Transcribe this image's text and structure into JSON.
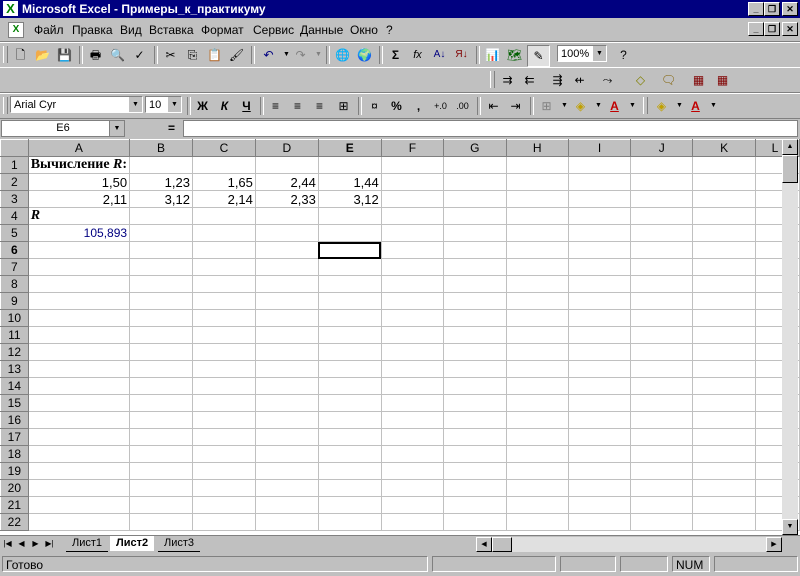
{
  "window": {
    "title": "Microsoft Excel - Примеры_к_практикуму"
  },
  "menu": [
    "Файл",
    "Правка",
    "Вид",
    "Вставка",
    "Формат",
    "Сервис",
    "Данные",
    "Окно",
    "?"
  ],
  "toolbar": {
    "zoom": "100%",
    "font": "Arial Cyr",
    "size": "10",
    "bold": "Ж",
    "italic": "К",
    "underline": "Ч",
    "percent": "%",
    "comma": ","
  },
  "formula_bar": {
    "cell_ref": "E6",
    "equals": "=",
    "content": ""
  },
  "grid": {
    "columns": [
      "A",
      "B",
      "C",
      "D",
      "E",
      "F",
      "G",
      "H",
      "I",
      "J",
      "K",
      "L"
    ],
    "active_column": "E",
    "active_row": 6,
    "rows": [
      {
        "n": "1",
        "cells": [
          "Вычисление R:",
          "",
          "",
          "",
          "",
          "",
          "",
          "",
          "",
          "",
          "",
          ""
        ]
      },
      {
        "n": "2",
        "cells": [
          "1,50",
          "1,23",
          "1,65",
          "2,44",
          "1,44",
          "",
          "",
          "",
          "",
          "",
          "",
          ""
        ]
      },
      {
        "n": "3",
        "cells": [
          "2,11",
          "3,12",
          "2,14",
          "2,33",
          "3,12",
          "",
          "",
          "",
          "",
          "",
          "",
          ""
        ]
      },
      {
        "n": "4",
        "cells": [
          "R",
          "",
          "",
          "",
          "",
          "",
          "",
          "",
          "",
          "",
          "",
          ""
        ]
      },
      {
        "n": "5",
        "cells": [
          "105,893",
          "",
          "",
          "",
          "",
          "",
          "",
          "",
          "",
          "",
          "",
          ""
        ]
      },
      {
        "n": "6",
        "cells": [
          "",
          "",
          "",
          "",
          "",
          "",
          "",
          "",
          "",
          "",
          "",
          ""
        ]
      },
      {
        "n": "7",
        "cells": [
          "",
          "",
          "",
          "",
          "",
          "",
          "",
          "",
          "",
          "",
          "",
          ""
        ]
      },
      {
        "n": "8",
        "cells": [
          "",
          "",
          "",
          "",
          "",
          "",
          "",
          "",
          "",
          "",
          "",
          ""
        ]
      },
      {
        "n": "9",
        "cells": [
          "",
          "",
          "",
          "",
          "",
          "",
          "",
          "",
          "",
          "",
          "",
          ""
        ]
      },
      {
        "n": "10",
        "cells": [
          "",
          "",
          "",
          "",
          "",
          "",
          "",
          "",
          "",
          "",
          "",
          ""
        ]
      },
      {
        "n": "11",
        "cells": [
          "",
          "",
          "",
          "",
          "",
          "",
          "",
          "",
          "",
          "",
          "",
          ""
        ]
      },
      {
        "n": "12",
        "cells": [
          "",
          "",
          "",
          "",
          "",
          "",
          "",
          "",
          "",
          "",
          "",
          ""
        ]
      },
      {
        "n": "13",
        "cells": [
          "",
          "",
          "",
          "",
          "",
          "",
          "",
          "",
          "",
          "",
          "",
          ""
        ]
      },
      {
        "n": "14",
        "cells": [
          "",
          "",
          "",
          "",
          "",
          "",
          "",
          "",
          "",
          "",
          "",
          ""
        ]
      },
      {
        "n": "15",
        "cells": [
          "",
          "",
          "",
          "",
          "",
          "",
          "",
          "",
          "",
          "",
          "",
          ""
        ]
      },
      {
        "n": "16",
        "cells": [
          "",
          "",
          "",
          "",
          "",
          "",
          "",
          "",
          "",
          "",
          "",
          ""
        ]
      },
      {
        "n": "17",
        "cells": [
          "",
          "",
          "",
          "",
          "",
          "",
          "",
          "",
          "",
          "",
          "",
          ""
        ]
      },
      {
        "n": "18",
        "cells": [
          "",
          "",
          "",
          "",
          "",
          "",
          "",
          "",
          "",
          "",
          "",
          ""
        ]
      },
      {
        "n": "19",
        "cells": [
          "",
          "",
          "",
          "",
          "",
          "",
          "",
          "",
          "",
          "",
          "",
          ""
        ]
      },
      {
        "n": "20",
        "cells": [
          "",
          "",
          "",
          "",
          "",
          "",
          "",
          "",
          "",
          "",
          "",
          ""
        ]
      },
      {
        "n": "21",
        "cells": [
          "",
          "",
          "",
          "",
          "",
          "",
          "",
          "",
          "",
          "",
          "",
          ""
        ]
      },
      {
        "n": "22",
        "cells": [
          "",
          "",
          "",
          "",
          "",
          "",
          "",
          "",
          "",
          "",
          "",
          ""
        ]
      }
    ]
  },
  "sheets": [
    {
      "name": "Лист1",
      "active": false
    },
    {
      "name": "Лист2",
      "active": true
    },
    {
      "name": "Лист3",
      "active": false
    }
  ],
  "status": {
    "text": "Готово",
    "num": "NUM"
  }
}
